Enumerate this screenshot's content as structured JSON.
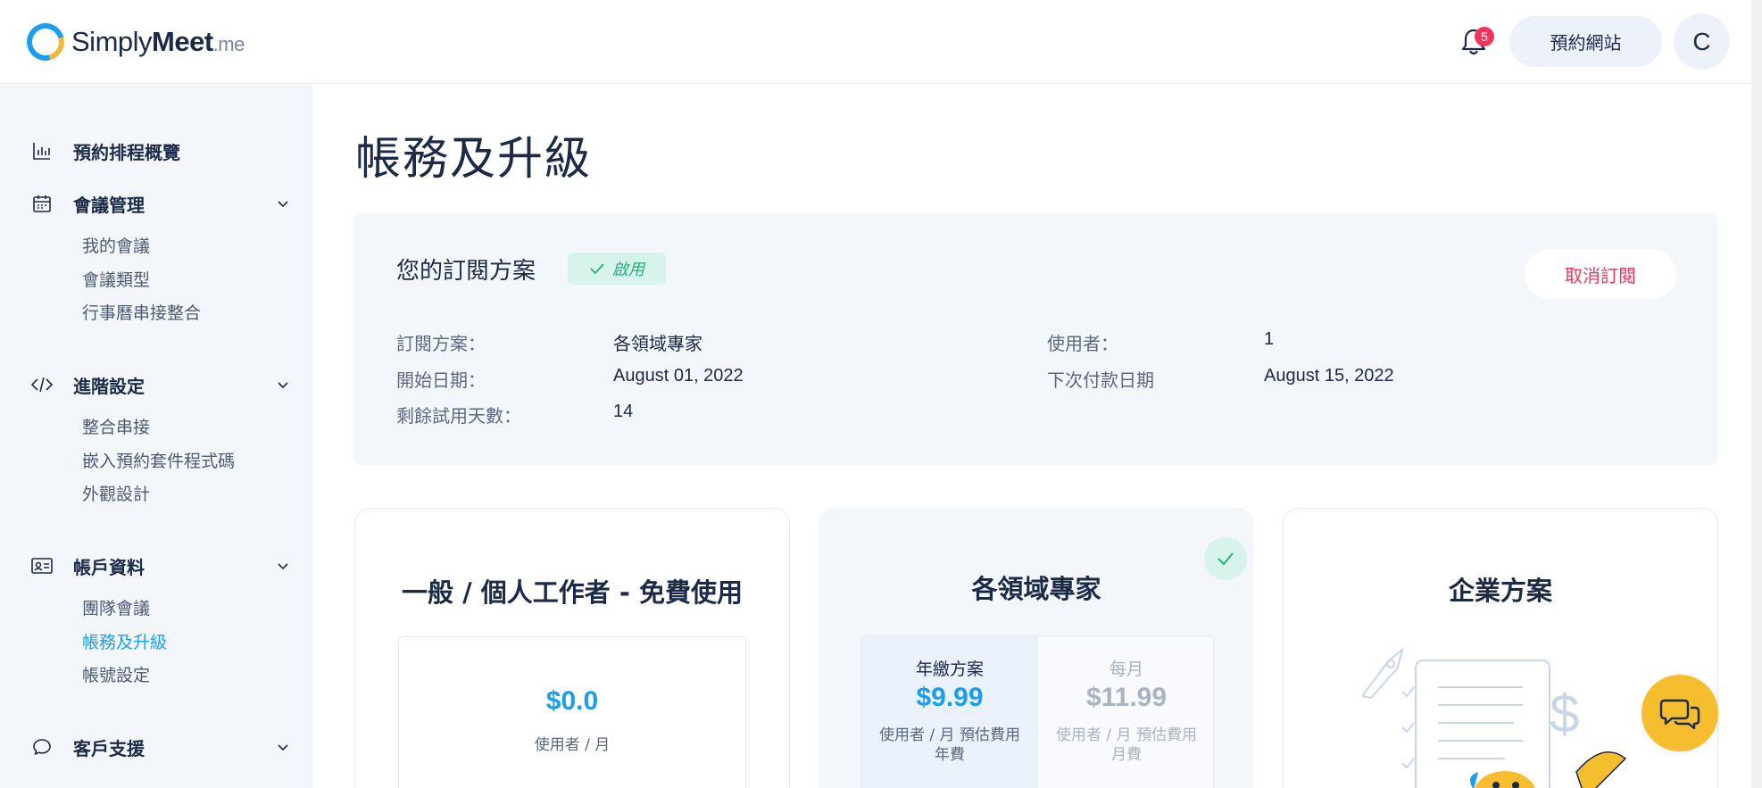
{
  "header": {
    "logo_simply": "Simply",
    "logo_meet": "Meet",
    "logo_suffix": ".me",
    "notification_count": "5",
    "site_button": "預約網站",
    "avatar_initial": "C"
  },
  "sidebar": {
    "overview": "預約排程概覽",
    "meetings": {
      "label": "會議管理",
      "items": [
        "我的會議",
        "會議類型",
        "行事曆串接整合"
      ]
    },
    "advanced": {
      "label": "進階設定",
      "items": [
        "整合串接",
        "嵌入預約套件程式碼",
        "外觀設計"
      ]
    },
    "account": {
      "label": "帳戶資料",
      "items": [
        "團隊會議",
        "帳務及升級",
        "帳號設定"
      ],
      "active_index": 1
    },
    "support": {
      "label": "客戶支援"
    }
  },
  "page": {
    "title": "帳務及升級"
  },
  "subscription": {
    "title": "您的訂閱方案",
    "status": "啟用",
    "cancel_button": "取消訂閱",
    "plan_label": "訂閱方案：",
    "plan_value": "各領域專家",
    "start_label": "開始日期：",
    "start_value": "August 01, 2022",
    "trial_label": "剩餘試用天數：",
    "trial_value": "14",
    "users_label": "使用者：",
    "users_value": "1",
    "next_payment_label": "下次付款日期",
    "next_payment_value": "August 15, 2022"
  },
  "plans": {
    "free": {
      "name": "一般 / 個人工作者 - 免費使用",
      "price": "$0.0",
      "unit": "使用者 / 月"
    },
    "pro": {
      "name": "各領域專家",
      "annual_label": "年繳方案",
      "annual_price": "$9.99",
      "annual_note": "使用者 / 月 預估費用 年費",
      "monthly_label": "每月",
      "monthly_price": "$11.99",
      "monthly_note": "使用者 / 月 預估費用 月費"
    },
    "enterprise": {
      "name": "企業方案"
    }
  },
  "colors": {
    "accent": "#1b9ef0",
    "danger": "#f0365c",
    "success": "#27b07f",
    "chat": "#f6bd2e"
  }
}
